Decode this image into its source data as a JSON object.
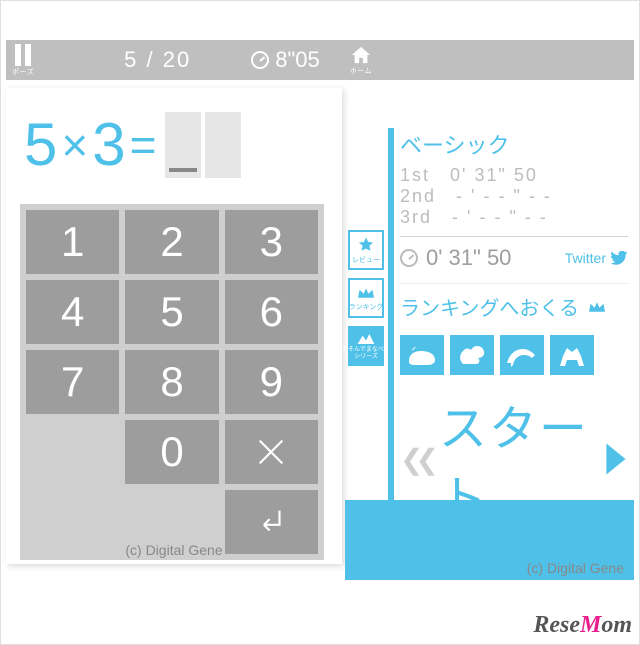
{
  "topbar": {
    "pause_label": "ポーズ",
    "progress": "5 / 20",
    "time": "8\"05",
    "home_label": "ホーム"
  },
  "equation": {
    "a": "5",
    "op": "×",
    "b": "3",
    "eq": "="
  },
  "keypad": {
    "k1": "1",
    "k2": "2",
    "k3": "3",
    "k4": "4",
    "k5": "5",
    "k6": "6",
    "k7": "7",
    "k8": "8",
    "k9": "9",
    "k0": "0"
  },
  "side": {
    "review": "レビュー",
    "ranking": "ランキング",
    "series_l1": "あそんでまなべる",
    "series_l2": "シリーズ"
  },
  "right": {
    "mode": "ベーシック",
    "rows": {
      "r1_label": "1st",
      "r1_time": "0' 31\" 50",
      "r2_label": "2nd",
      "r2_time": "- ' - - \" - -",
      "r3_label": "3rd",
      "r3_time": "- ' - - \" - -"
    },
    "best": "0' 31\" 50",
    "twitter": "Twitter",
    "ranking_link": "ランキングへおくる",
    "start": "スタート"
  },
  "footer": {
    "copyright": "(c) Digital Gene",
    "watermark_a": "Rese",
    "watermark_b": "M",
    "watermark_c": "om"
  }
}
